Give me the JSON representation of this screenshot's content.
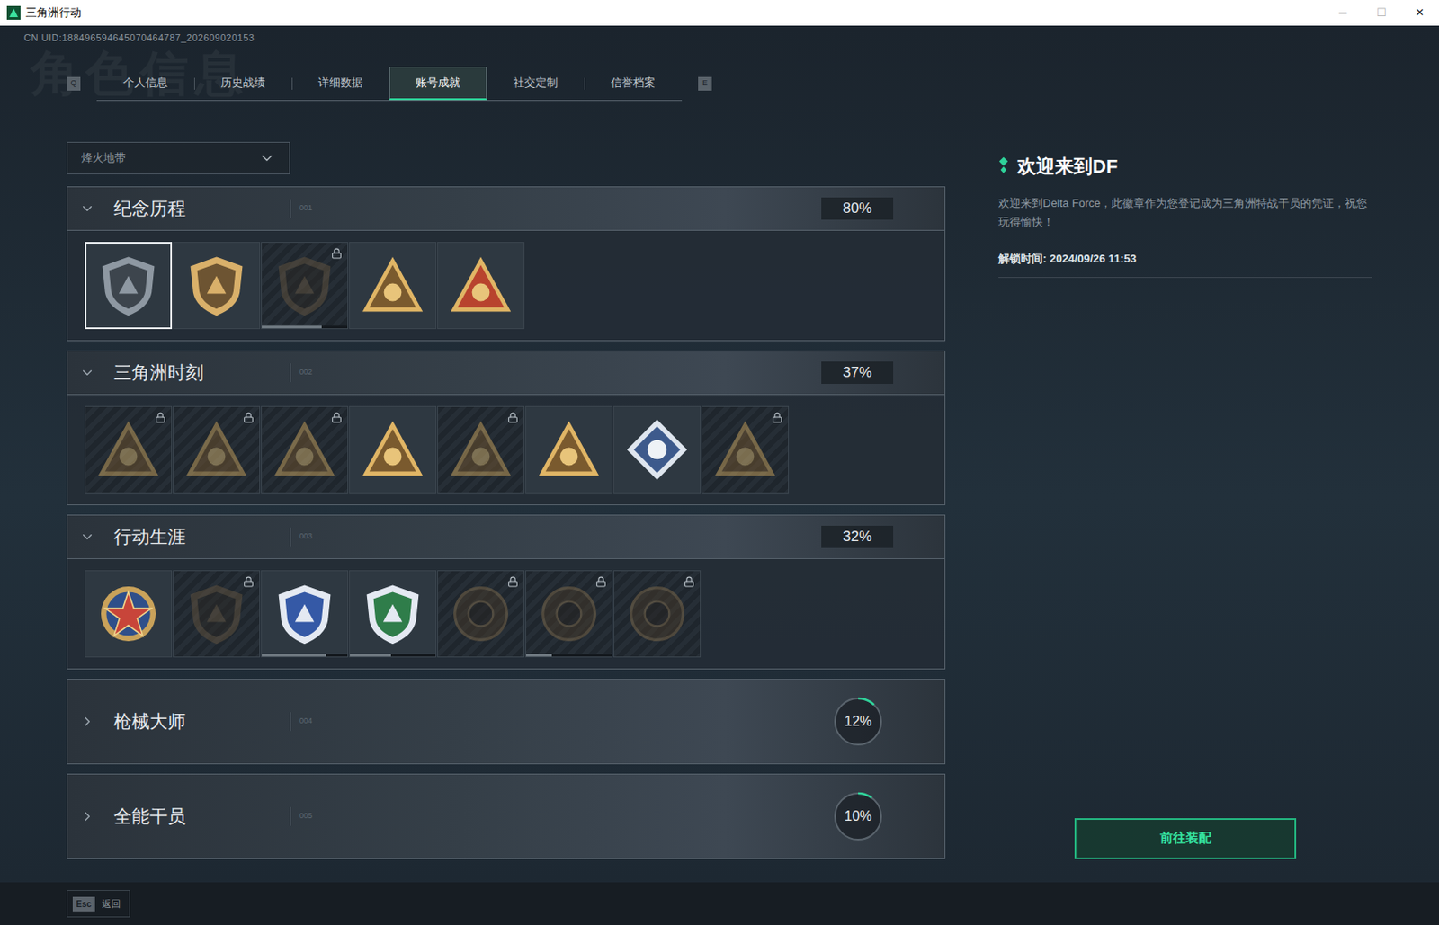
{
  "window": {
    "title": "三角洲行动",
    "controls": [
      "─",
      "☐",
      "✕"
    ]
  },
  "uid": "CN UID:188496594645070464787_202609020153",
  "watermark": "角色信息",
  "tabs": {
    "prev_key": "Q",
    "next_key": "E",
    "items": [
      {
        "label": "个人信息",
        "selected": false
      },
      {
        "label": "历史战绩",
        "selected": false
      },
      {
        "label": "详细数据",
        "selected": false
      },
      {
        "label": "账号成就",
        "selected": true
      },
      {
        "label": "社交定制",
        "selected": false
      },
      {
        "label": "信誉档案",
        "selected": false
      }
    ]
  },
  "filter": {
    "value": "烽火地带"
  },
  "sections": [
    {
      "title": "纪念历程",
      "number": "001",
      "percent": "80%",
      "level": 0.8,
      "expanded": true,
      "badges": [
        {
          "locked": false,
          "selected": true
        },
        {
          "locked": false,
          "selected": false
        },
        {
          "locked": true,
          "selected": false,
          "level": 0.7
        },
        {
          "locked": false,
          "selected": false
        },
        {
          "locked": false,
          "selected": false
        }
      ]
    },
    {
      "title": "三角洲时刻",
      "number": "002",
      "percent": "37%",
      "level": 0.37,
      "expanded": true,
      "badges": [
        {
          "locked": true,
          "selected": false
        },
        {
          "locked": true,
          "selected": false
        },
        {
          "locked": true,
          "selected": false
        },
        {
          "locked": false,
          "selected": false
        },
        {
          "locked": true,
          "selected": false
        },
        {
          "locked": false,
          "selected": false
        },
        {
          "locked": false,
          "selected": false
        },
        {
          "locked": true,
          "selected": false
        }
      ]
    },
    {
      "title": "行动生涯",
      "number": "003",
      "percent": "32%",
      "level": 0.32,
      "expanded": true,
      "badges": [
        {
          "locked": false,
          "selected": false
        },
        {
          "locked": true,
          "selected": false
        },
        {
          "locked": false,
          "selected": false,
          "level": 0.75
        },
        {
          "locked": false,
          "selected": false,
          "level": 0.48
        },
        {
          "locked": true,
          "selected": false
        },
        {
          "locked": true,
          "selected": false,
          "level": 0.3
        },
        {
          "locked": true,
          "selected": false
        }
      ]
    },
    {
      "title": "枪械大师",
      "number": "004",
      "percent": "12%",
      "level": 0.12,
      "expanded": false,
      "badges": []
    },
    {
      "title": "全能干员",
      "number": "005",
      "percent": "10%",
      "level": 0.1,
      "expanded": false,
      "badges": []
    }
  ],
  "detail": {
    "title": "欢迎来到DF",
    "description": "欢迎来到Delta Force，此徽章作为您登记成为三角洲特战干员的凭证，祝您玩得愉快！",
    "unlock": "解锁时间: 2024/09/26 11:53"
  },
  "button": "前往装配",
  "footer": {
    "key": "Esc",
    "label": "返回"
  }
}
